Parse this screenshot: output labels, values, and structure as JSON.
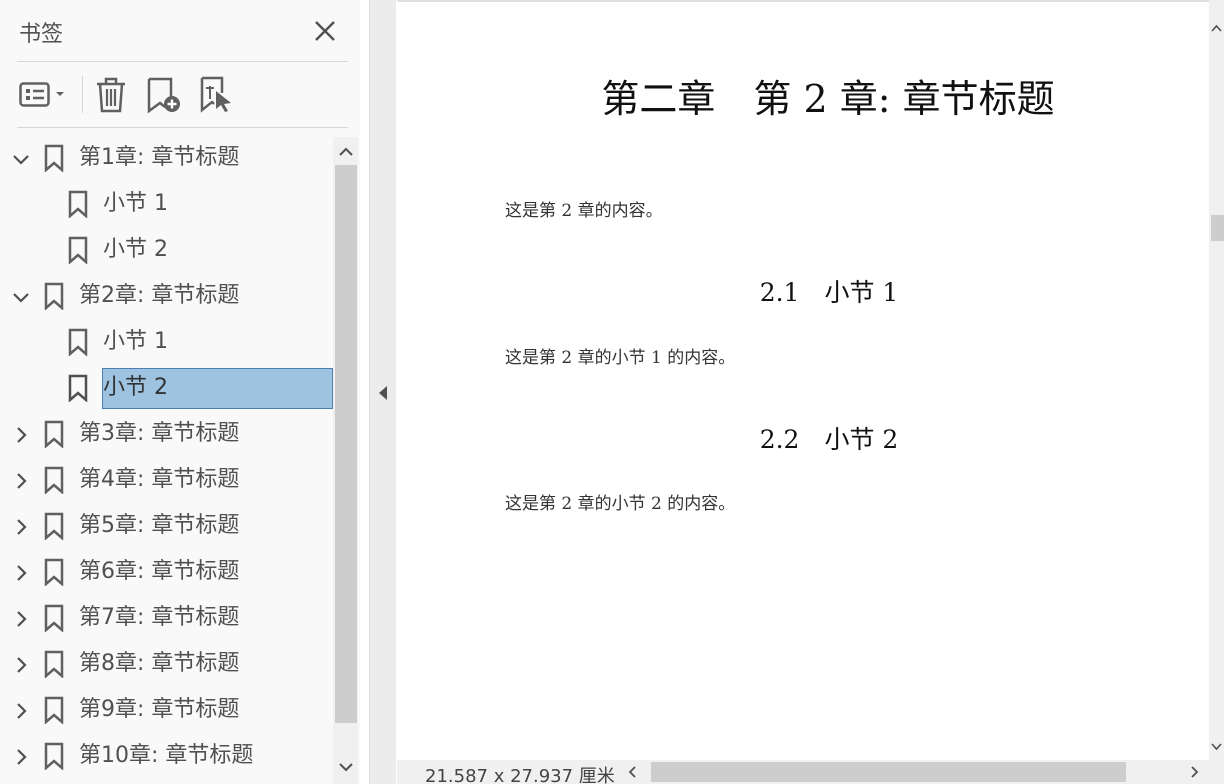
{
  "panel": {
    "title": "书签",
    "toolbar": {
      "options_icon": "list-options-icon",
      "delete_icon": "trash-icon",
      "new_bookmark_icon": "add-bookmark-icon",
      "bookmark_from_selection_icon": "bookmark-cursor-icon"
    },
    "items": [
      {
        "label": "第1章: 章节标题",
        "level": 0,
        "expanded": true
      },
      {
        "label": "小节 1",
        "level": 1
      },
      {
        "label": "小节 2",
        "level": 1
      },
      {
        "label": "第2章: 章节标题",
        "level": 0,
        "expanded": true
      },
      {
        "label": "小节 1",
        "level": 1
      },
      {
        "label": "小节 2",
        "level": 1,
        "selected": true
      },
      {
        "label": "第3章: 章节标题",
        "level": 0,
        "expanded": false
      },
      {
        "label": "第4章: 章节标题",
        "level": 0,
        "expanded": false
      },
      {
        "label": "第5章: 章节标题",
        "level": 0,
        "expanded": false
      },
      {
        "label": "第6章: 章节标题",
        "level": 0,
        "expanded": false
      },
      {
        "label": "第7章: 章节标题",
        "level": 0,
        "expanded": false
      },
      {
        "label": "第8章: 章节标题",
        "level": 0,
        "expanded": false
      },
      {
        "label": "第9章: 章节标题",
        "level": 0,
        "expanded": false
      },
      {
        "label": "第10章: 章节标题",
        "level": 0,
        "expanded": false
      }
    ]
  },
  "document": {
    "chapter_title": "第二章　第 2 章: 章节标题",
    "intro": "这是第 2 章的内容。",
    "sections": [
      {
        "heading": "2.1　小节 1",
        "body": "这是第 2 章的小节 1 的内容。"
      },
      {
        "heading": "2.2　小节 2",
        "body": "这是第 2 章的小节 2 的内容。"
      }
    ]
  },
  "status": {
    "page_size": "21.587 x 27.937 厘米"
  },
  "colors": {
    "selection": "#9dc3e1",
    "selection_border": "#4d7fb0",
    "panel_bg": "#f9f9f9"
  }
}
